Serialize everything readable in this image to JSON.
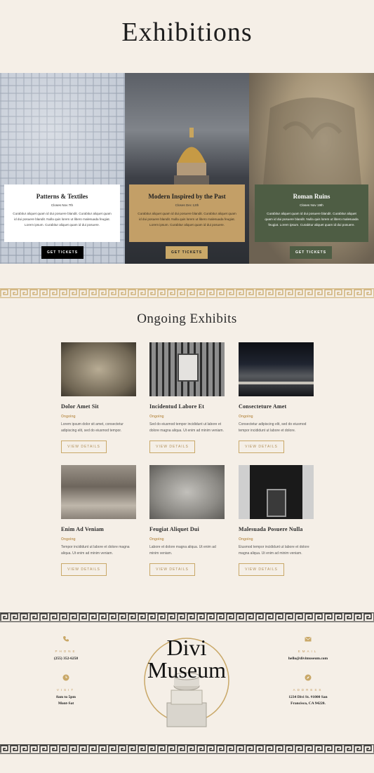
{
  "page": {
    "title": "Exhibitions"
  },
  "featured": [
    {
      "title": "Patterns & Textiles",
      "date": "Closes Nov 7th",
      "text": "Curabitur aliquet quam id dui posuere blandit. Curabitur aliquet quam id dui posuere blandit. Nulla quis lorem ut libero malesuada feugiat. Lorem ipsum. Curabitur aliquet quam id dui posuere.",
      "button": "GET TICKETS",
      "style": "white"
    },
    {
      "title": "Modern Inspired by the Past",
      "date": "Closes Dec 12th",
      "text": "Curabitur aliquet quam id dui posuere blandit. Curabitur aliquet quam id dui posuere blandit. Nulla quis lorem ut libero malesuada feugiat. Lorem ipsum. Curabitur aliquet quam id dui posuere.",
      "button": "GET TICKETS",
      "style": "gold"
    },
    {
      "title": "Roman Ruins",
      "date": "Closes Nov 19th",
      "text": "Curabitur aliquet quam id dui posuere blandit. Curabitur aliquet quam id dui posuere blandit. Nulla quis lorem ut libero malesuada feugiat. Lorem ipsum. Curabitur aliquet quam id dui posuere.",
      "button": "GET TICKETS",
      "style": "green"
    }
  ],
  "ongoing": {
    "heading": "Ongoing Exhibits",
    "items": [
      {
        "name": "Dolor Amet Sit",
        "status": "Ongoing",
        "desc": "Lorem ipsum dolor sit amet, consectetur adipiscing elit, sed do eiusmod tempor.",
        "button": "VIEW DETAILS"
      },
      {
        "name": "Incidentud Labore Et",
        "status": "Ongoing",
        "desc": "Sed do eiusmod tempor incididunt ut labore et dolore magna aliqua. Ut enim ad minim veniam.",
        "button": "VIEW DETAILS"
      },
      {
        "name": "Consecteture Amet",
        "status": "Ongoing",
        "desc": "Consectetur adipiscing elit, sed do eiusmod tempor incididunt ut labore et dolore.",
        "button": "VIEW DETAILS"
      },
      {
        "name": "Enim Ad Veniam",
        "status": "Ongoing",
        "desc": "Tempor incididunt ut labore et dolore magna aliqua. Ut enim ad minim veniam.",
        "button": "VIEW DETAILS"
      },
      {
        "name": "Feugiat Aliquet Dui",
        "status": "Ongoing",
        "desc": "Labore et dolore magna aliqua. Ut enim ad minim veniam.",
        "button": "VIEW DETAILS"
      },
      {
        "name": "Malesuada Posuere Nulla",
        "status": "Ongoing",
        "desc": "Eiusmod tempor incididunt ut labore et dolore magna aliqua. Ut enim ad minim veniam.",
        "button": "VIEW DETAILS"
      }
    ]
  },
  "footer": {
    "logo_line1": "Divi",
    "logo_line2": "Museum",
    "phone": {
      "label": "PHONE",
      "value": "(255) 352-6258",
      "icon": "phone-icon"
    },
    "visit": {
      "label": "VISIT",
      "value1": "8am to 5pm",
      "value2": "Mont-Sat",
      "icon": "clock-icon"
    },
    "email": {
      "label": "EMAIL",
      "value": "hello@divimuseum.com",
      "icon": "envelope-icon"
    },
    "address": {
      "label": "ADDRESS",
      "value1": "1234 Divi St. #1000 San",
      "value2": "Francisco, CA 94220.",
      "icon": "compass-icon"
    }
  },
  "colors": {
    "background": "#f5efe7",
    "gold": "#c9a868",
    "green": "#4e5d44",
    "text": "#2a2a2a"
  }
}
